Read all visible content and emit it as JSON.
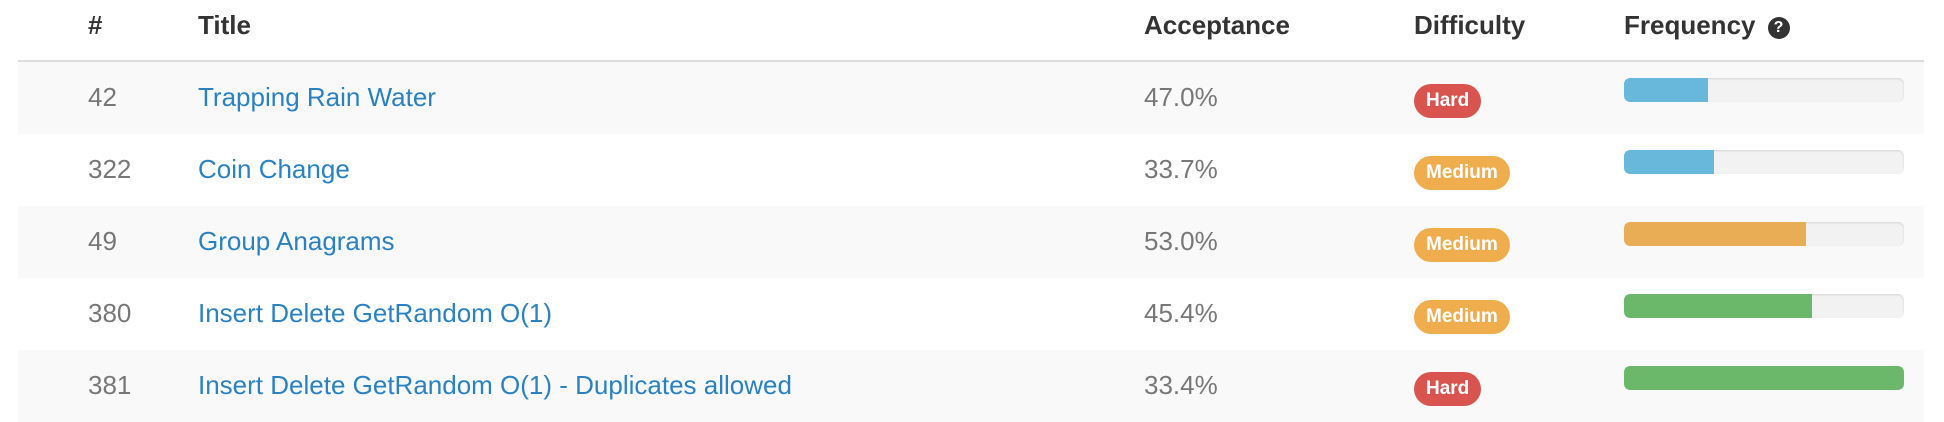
{
  "header": {
    "num_label": "#",
    "title_label": "Title",
    "acceptance_label": "Acceptance",
    "difficulty_label": "Difficulty",
    "frequency_label": "Frequency",
    "help_icon_glyph": "?"
  },
  "colors": {
    "link": "#2a82c4",
    "hard": "#d9534f",
    "medium": "#f0ad4e",
    "freq_blue": "#5bc0de",
    "freq_orange": "#f0ad4e",
    "freq_green": "#5cb85c"
  },
  "rows": [
    {
      "num": "42",
      "title": "Trapping Rain Water",
      "acceptance": "47.0%",
      "difficulty": "Hard",
      "frequency_pct": 30,
      "frequency_color": "#68b8dc"
    },
    {
      "num": "322",
      "title": "Coin Change",
      "acceptance": "33.7%",
      "difficulty": "Medium",
      "frequency_pct": 32,
      "frequency_color": "#68b8dc"
    },
    {
      "num": "49",
      "title": "Group Anagrams",
      "acceptance": "53.0%",
      "difficulty": "Medium",
      "frequency_pct": 65,
      "frequency_color": "#e8ad55"
    },
    {
      "num": "380",
      "title": "Insert Delete GetRandom O(1)",
      "acceptance": "45.4%",
      "difficulty": "Medium",
      "frequency_pct": 67,
      "frequency_color": "#6bb86b"
    },
    {
      "num": "381",
      "title": "Insert Delete GetRandom O(1) - Duplicates allowed",
      "acceptance": "33.4%",
      "difficulty": "Hard",
      "frequency_pct": 100,
      "frequency_color": "#6bb86b"
    }
  ]
}
